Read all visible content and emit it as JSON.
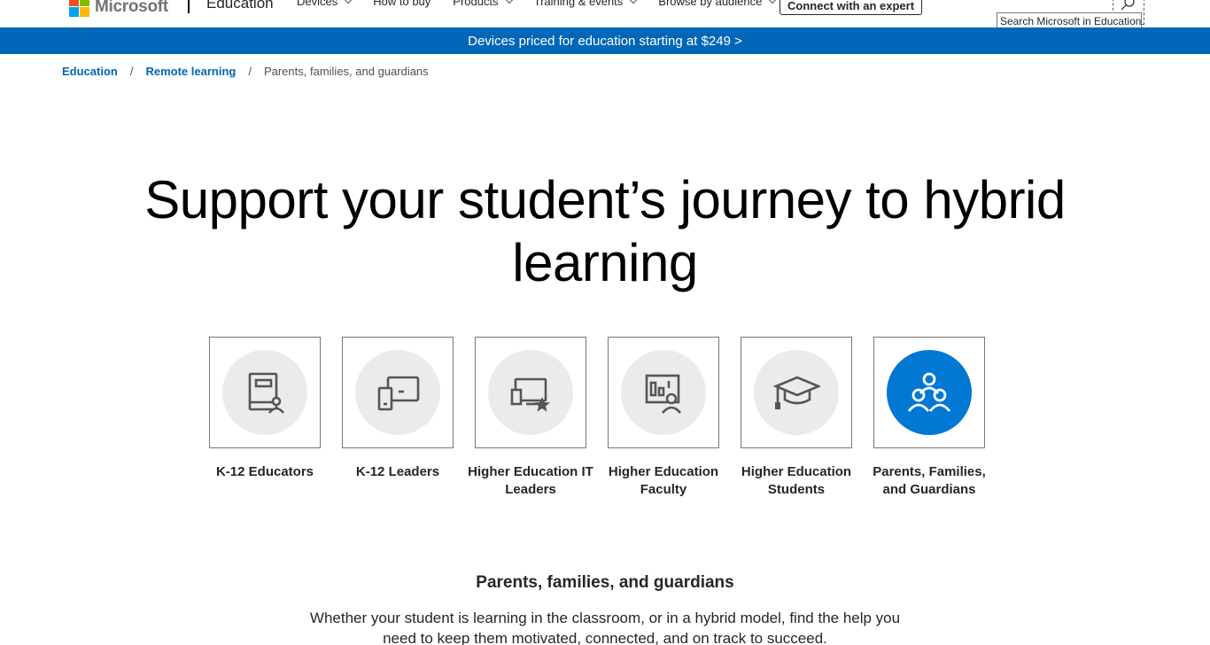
{
  "header": {
    "brand": "Microsoft",
    "site_title": "Education",
    "nav": [
      {
        "label": "Devices",
        "has_menu": true
      },
      {
        "label": "How to buy",
        "has_menu": false
      },
      {
        "label": "Products",
        "has_menu": true
      },
      {
        "label": "Training & events",
        "has_menu": true
      },
      {
        "label": "Browse by audience",
        "has_menu": true
      }
    ],
    "cta_label": "Connect with an expert",
    "search_tooltip": "Search Microsoft in Education",
    "search_icon": "search-icon"
  },
  "banner": {
    "text": "Devices priced for education starting at $249 >"
  },
  "breadcrumb": {
    "items": [
      "Education",
      "Remote learning"
    ],
    "separator": "/",
    "current": "Parents, families, and guardians"
  },
  "hero": {
    "title": "Support your student’s journey to hybrid learning"
  },
  "audiences": [
    {
      "label": "K-12 Educators",
      "icon": "book-person-icon",
      "active": false
    },
    {
      "label": "K-12 Leaders",
      "icon": "devices-icon",
      "active": false
    },
    {
      "label": "Higher Education IT Leaders",
      "icon": "monitor-star-icon",
      "active": false
    },
    {
      "label": "Higher Education Faculty",
      "icon": "board-person-icon",
      "active": false
    },
    {
      "label": "Higher Education Students",
      "icon": "graduation-cap-icon",
      "active": false
    },
    {
      "label": "Parents, Families, and Guardians",
      "icon": "family-icon",
      "active": true
    }
  ],
  "section": {
    "title": "Parents, families, and guardians",
    "body": "Whether your student is learning in the classroom, or in a hybrid model, find the help you need to keep them motivated, connected, and on track to succeed."
  },
  "colors": {
    "brand_blue": "#0067b8",
    "active_tile": "#0078d4",
    "tile_inactive": "#ebebeb"
  }
}
